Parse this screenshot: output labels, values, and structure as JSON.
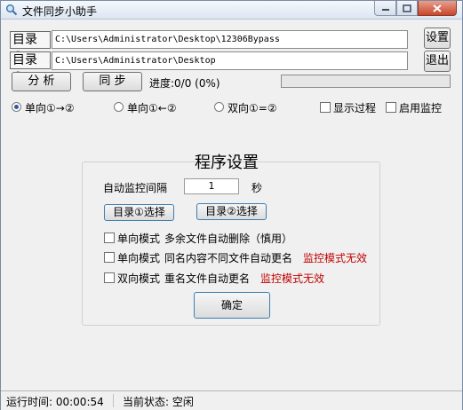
{
  "window": {
    "title": "文件同步小助手",
    "icons": {
      "app": "magnifier-app-icon",
      "minimize": "minimize-icon",
      "maximize": "maximize-icon",
      "close": "close-icon"
    }
  },
  "dirs": {
    "dir1_label": "目录①",
    "dir1_path": "C:\\Users\\Administrator\\Desktop\\12306Bypass",
    "dir2_label": "目录②",
    "dir2_path": "C:\\Users\\Administrator\\Desktop"
  },
  "buttons": {
    "settings": "设置",
    "exit": "退出",
    "analyze": "分 析",
    "sync": "同 步"
  },
  "progress": {
    "label": "进度:0/0 (0%)",
    "value": 0
  },
  "modes": {
    "one_way_right": "单向①→②",
    "one_way_left": "单向①←②",
    "two_way": "双向①=②",
    "selected": "one_way_right"
  },
  "options": {
    "show_process": "显示过程",
    "enable_monitor": "启用监控"
  },
  "settings_panel": {
    "title": "程序设置",
    "interval_label": "自动监控间隔",
    "interval_value": "1",
    "interval_unit": "秒",
    "dir1_select": "目录①选择",
    "dir2_select": "目录②选择",
    "opt1_mode": "单向模式",
    "opt1_text": "多余文件自动删除（慎用）",
    "opt2_mode": "单向模式",
    "opt2_text": "同名内容不同文件自动更名",
    "opt2_warning": "监控模式无效",
    "opt3_mode": "双向模式",
    "opt3_text": "重名文件自动更名",
    "opt3_warning": "监控模式无效",
    "confirm": "确定"
  },
  "status": {
    "runtime": "运行时间: 00:00:54",
    "state": "当前状态: 空闲"
  },
  "colors": {
    "warning": "#c00000",
    "progress_fill": "#06b025",
    "focus": "#3c7fb1"
  }
}
